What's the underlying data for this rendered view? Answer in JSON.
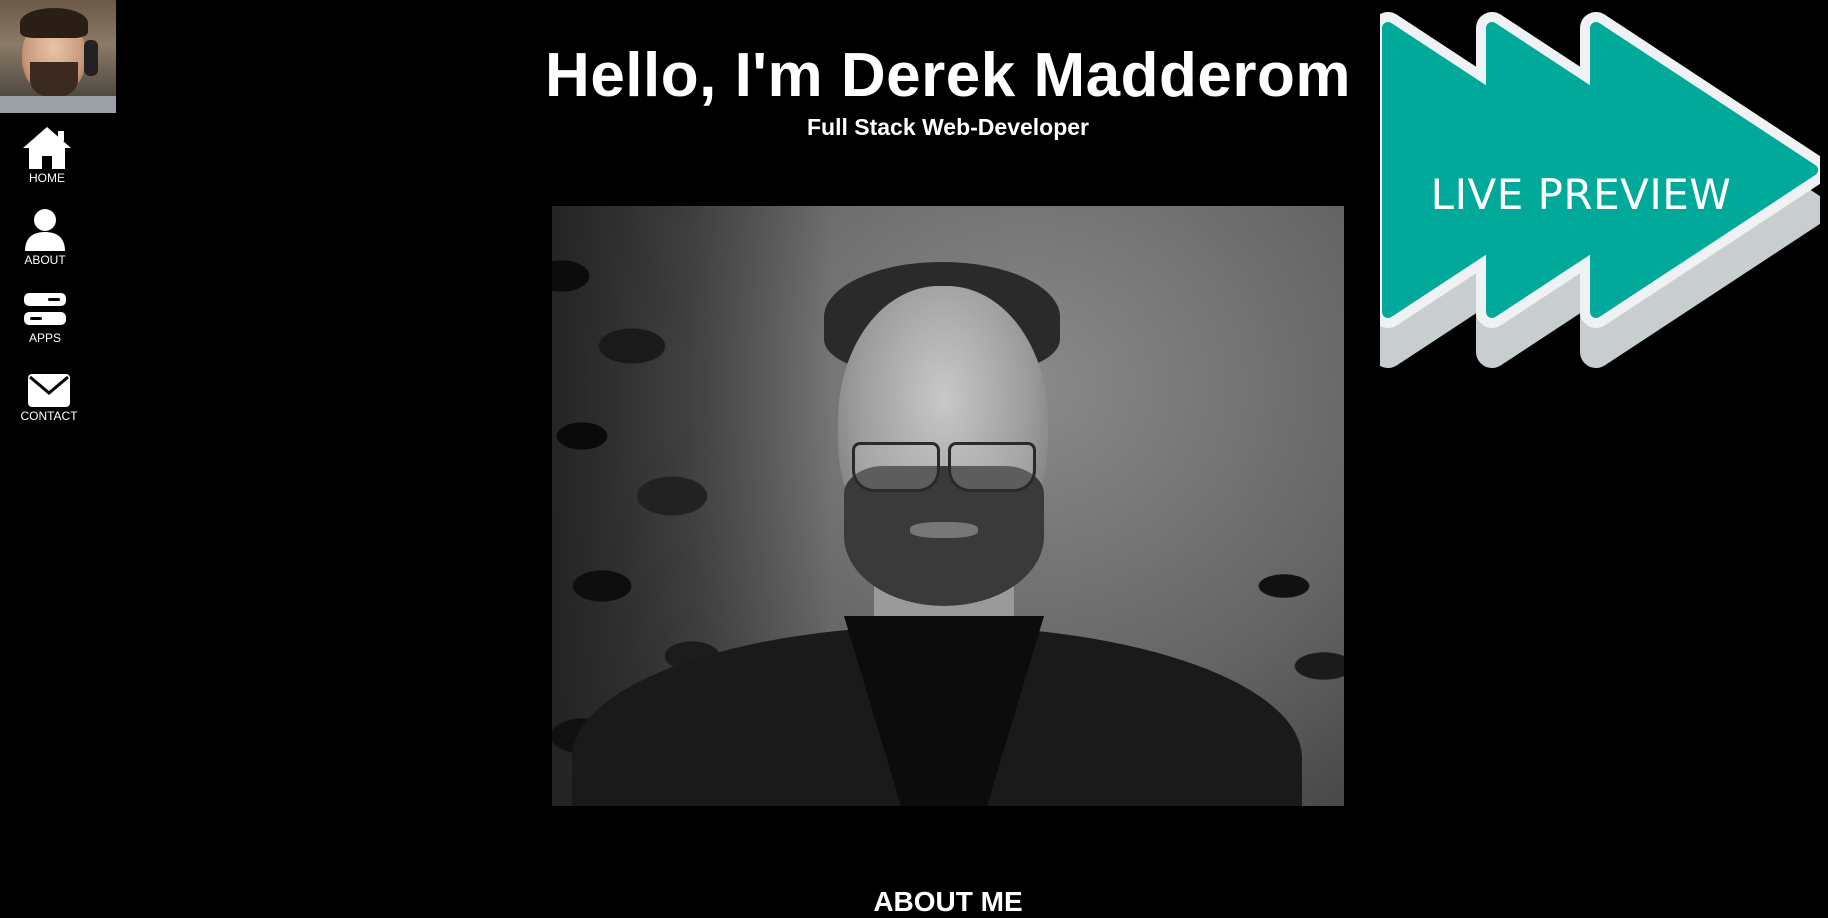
{
  "sidebar": {
    "items": [
      {
        "label": "HOME",
        "icon": "home-icon"
      },
      {
        "label": "ABOUT",
        "icon": "person-icon"
      },
      {
        "label": "APPS",
        "icon": "apps-icon"
      },
      {
        "label": "CONTACT",
        "icon": "envelope-icon"
      }
    ]
  },
  "header": {
    "title": "Hello, I'm Derek Madderom",
    "subtitle": "Full Stack Web-Developer"
  },
  "about": {
    "heading": "ABOUT ME"
  },
  "live_preview": {
    "label": "LIVE PREVIEW",
    "accent_color": "#00a99a",
    "outline_color": "#eef2f2",
    "shadow_color": "#c8ced0"
  },
  "colors": {
    "background": "#000000",
    "text": "#ffffff"
  }
}
